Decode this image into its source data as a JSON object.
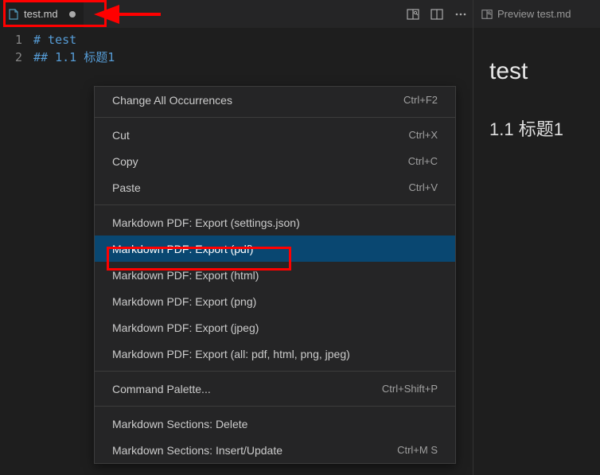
{
  "tab": {
    "filename": "test.md",
    "dirty": true
  },
  "preview_tab": {
    "label": "Preview test.md"
  },
  "editor": {
    "lines": [
      {
        "num": "1",
        "text": "# test"
      },
      {
        "num": "2",
        "text": "## 1.1 标题1"
      }
    ]
  },
  "preview": {
    "h1": "test",
    "h2": "1.1 标题1"
  },
  "context_menu": {
    "groups": [
      [
        {
          "label": "Change All Occurrences",
          "shortcut": "Ctrl+F2",
          "selected": false
        }
      ],
      [
        {
          "label": "Cut",
          "shortcut": "Ctrl+X",
          "selected": false
        },
        {
          "label": "Copy",
          "shortcut": "Ctrl+C",
          "selected": false
        },
        {
          "label": "Paste",
          "shortcut": "Ctrl+V",
          "selected": false
        }
      ],
      [
        {
          "label": "Markdown PDF: Export (settings.json)",
          "shortcut": "",
          "selected": false
        },
        {
          "label": "Markdown PDF: Export (pdf)",
          "shortcut": "",
          "selected": true
        },
        {
          "label": "Markdown PDF: Export (html)",
          "shortcut": "",
          "selected": false
        },
        {
          "label": "Markdown PDF: Export (png)",
          "shortcut": "",
          "selected": false
        },
        {
          "label": "Markdown PDF: Export (jpeg)",
          "shortcut": "",
          "selected": false
        },
        {
          "label": "Markdown PDF: Export (all: pdf, html, png, jpeg)",
          "shortcut": "",
          "selected": false
        }
      ],
      [
        {
          "label": "Command Palette...",
          "shortcut": "Ctrl+Shift+P",
          "selected": false
        }
      ],
      [
        {
          "label": "Markdown Sections: Delete",
          "shortcut": "",
          "selected": false
        },
        {
          "label": "Markdown Sections: Insert/Update",
          "shortcut": "Ctrl+M S",
          "selected": false
        }
      ]
    ]
  }
}
